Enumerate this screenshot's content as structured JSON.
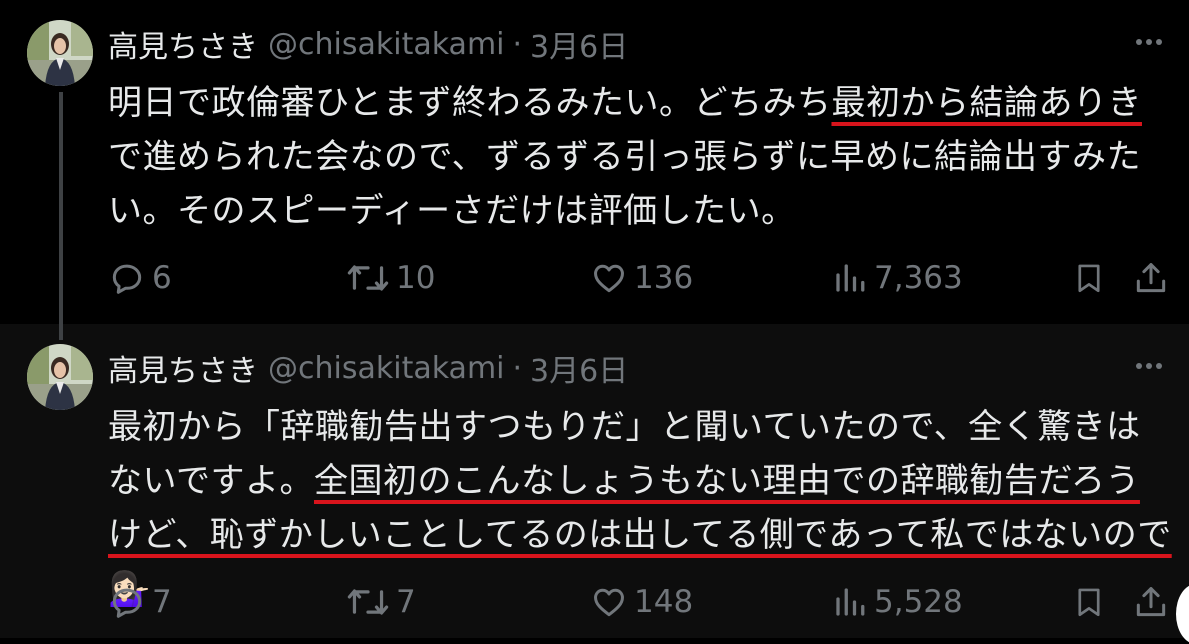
{
  "tweets": [
    {
      "name": "高見ちさき",
      "handle": "@chisakitakami",
      "separator": "·",
      "date": "3月6日",
      "text_parts": [
        "明日で政倫審ひとまず終わるみたい。どちみち",
        "最初から結論ありき",
        "で進められた会なので、ずるずる引っ張らずに早めに結論出すみたい。そのスピーディーさだけは評価したい。"
      ],
      "replies": "6",
      "retweets": "10",
      "likes": "136",
      "views": "7,363"
    },
    {
      "name": "高見ちさき",
      "handle": "@chisakitakami",
      "separator": "·",
      "date": "3月6日",
      "text_parts": [
        "最初から「辞職勧告出すつもりだ」と聞いていたので、全く驚きはないですよ。",
        "全国初のこんなしょうもない理由での辞職勧告だろうけど、恥ずかしいことしてるのは出してる側であって私ではないので",
        "💁🏻‍♀️"
      ],
      "replies": "7",
      "retweets": "7",
      "likes": "148",
      "views": "5,528"
    }
  ],
  "icons": {
    "more": "more-horizontal-icon",
    "reply": "reply-icon",
    "retweet": "retweet-icon",
    "like": "heart-icon",
    "views": "analytics-icon",
    "bookmark": "bookmark-icon",
    "share": "share-icon"
  },
  "colors": {
    "background": "#000000",
    "text": "#e7e9ea",
    "secondary": "#71767b",
    "underline": "#d8141c"
  }
}
